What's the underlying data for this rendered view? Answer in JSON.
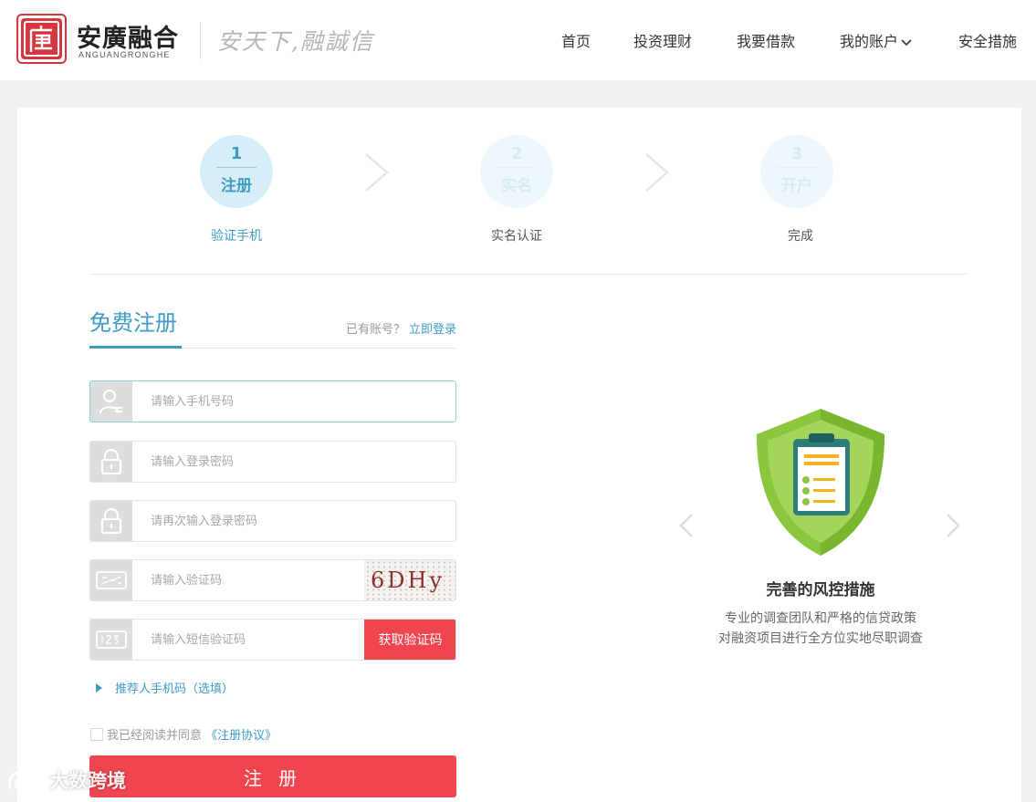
{
  "header": {
    "brand_name": "安廣融合",
    "brand_sub": "ANGUANGRONGHE",
    "slogan": "安天下,融誠信",
    "nav": [
      {
        "label": "首页"
      },
      {
        "label": "投资理财"
      },
      {
        "label": "我要借款"
      },
      {
        "label": "我的账户"
      },
      {
        "label": "安全措施"
      }
    ]
  },
  "steps": [
    {
      "number": "1",
      "label": "注册",
      "caption": "验证手机"
    },
    {
      "number": "2",
      "label": "实名",
      "caption": "实名认证"
    },
    {
      "number": "3",
      "label": "开户",
      "caption": "完成"
    }
  ],
  "form": {
    "title": "免费注册",
    "have_account_text": "已有账号？",
    "login_link": "立即登录",
    "phone_placeholder": "请输入手机号码",
    "password_placeholder": "请输入登录密码",
    "password_confirm_placeholder": "请再次输入登录密码",
    "captcha_placeholder": "请输入验证码",
    "captcha_text": "6DHy",
    "sms_placeholder": "请输入短信验证码",
    "sms_button": "获取验证码",
    "referrer_text": "推荐人手机码（选填）",
    "agree_text": "我已经阅读并同意",
    "agree_link": "《注册协议》",
    "submit_label": "注 册"
  },
  "promo": {
    "title": "完善的风控措施",
    "desc_line1": "专业的调查团队和严格的信贷政策",
    "desc_line2": "对融资项目进行全方位实地尽职调查"
  },
  "watermark": "大数跨境",
  "colors": {
    "accent_blue": "#3f9bc6",
    "accent_red": "#f04450",
    "brand_red": "#d7363e",
    "shield_green": "#8cc63f"
  }
}
